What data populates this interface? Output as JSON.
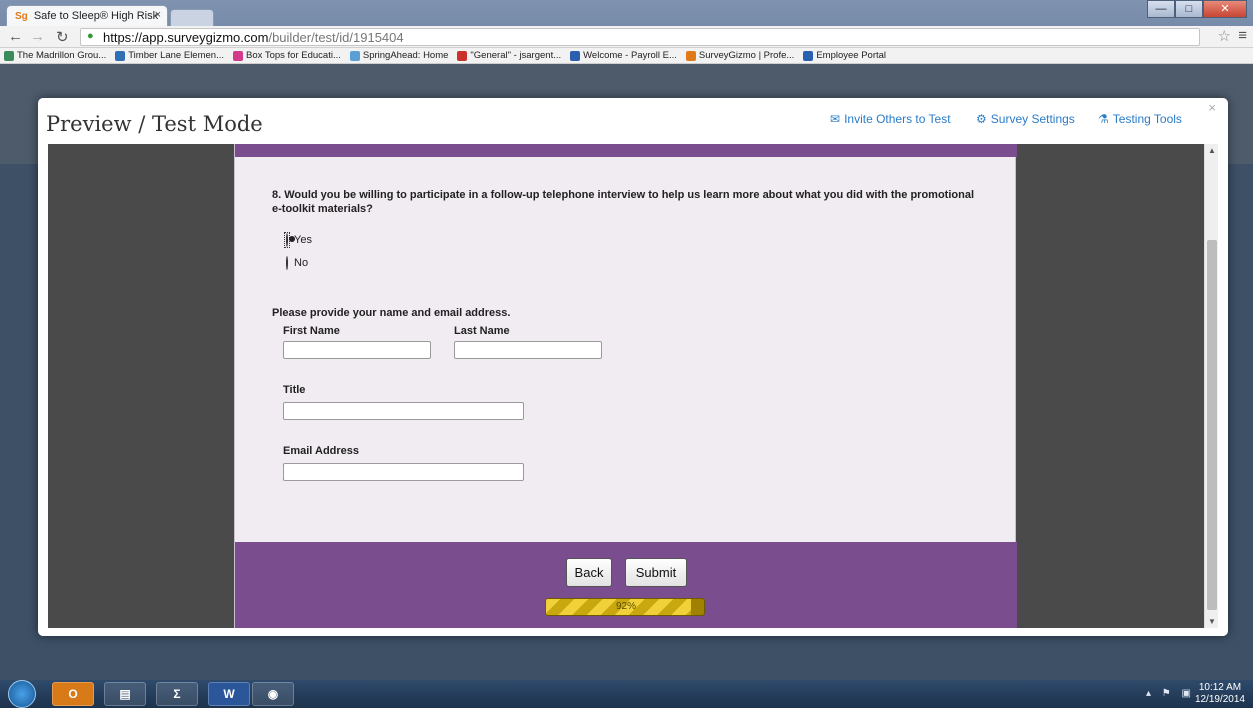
{
  "browser": {
    "tab_title": "Safe to Sleep® High Risk",
    "tab_close": "×",
    "tab_favicon": "Sg",
    "url_host": "https://app.surveygizmo.com",
    "url_path": "/builder/test/id/1915404",
    "bookmarks": [
      {
        "label": "The Madrillon Grou...",
        "color": "#3a8a5a"
      },
      {
        "label": "Timber Lane Elemen...",
        "color": "#2f6fb5"
      },
      {
        "label": "Box Tops for Educati...",
        "color": "#d23a8a"
      },
      {
        "label": "SpringAhead: Home",
        "color": "#5aa0d8"
      },
      {
        "label": "\"General\" - jsargent...",
        "color": "#c8322a"
      },
      {
        "label": "Welcome - Payroll E...",
        "color": "#2a5fb0"
      },
      {
        "label": "SurveyGizmo | Profe...",
        "color": "#e07a18"
      },
      {
        "label": "Employee Portal",
        "color": "#2a5fb0"
      }
    ]
  },
  "modal": {
    "title": "Preview / Test Mode",
    "invite_label": "Invite Others to Test",
    "settings_label": "Survey Settings",
    "testing_label": "Testing Tools",
    "close": "×"
  },
  "survey": {
    "question8": "8. Would you be willing to participate in a follow-up telephone interview to help us learn more about what you did with the promotional e-toolkit materials?",
    "options": [
      {
        "label": "Yes",
        "checked": true
      },
      {
        "label": "No",
        "checked": false
      }
    ],
    "contact_prompt": "Please provide your name and email address.",
    "first_name_label": "First Name",
    "last_name_label": "Last Name",
    "title_label": "Title",
    "email_label": "Email Address",
    "first_name_value": "",
    "last_name_value": "",
    "title_value": "",
    "email_value": "",
    "back_label": "Back",
    "submit_label": "Submit",
    "progress_text": "92%",
    "progress_fraction": 0.92
  },
  "taskbar": {
    "time": "10:12 AM",
    "date": "12/19/2014"
  }
}
